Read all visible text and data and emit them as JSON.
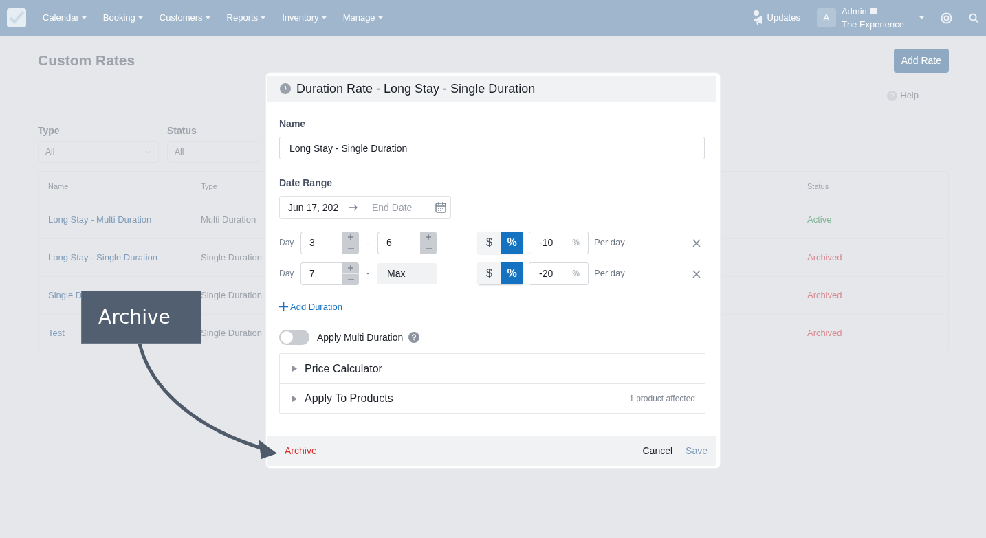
{
  "navbar": {
    "menu": [
      {
        "label": "Calendar"
      },
      {
        "label": "Booking"
      },
      {
        "label": "Customers"
      },
      {
        "label": "Reports"
      },
      {
        "label": "Inventory"
      },
      {
        "label": "Manage"
      }
    ],
    "updates": "Updates",
    "avatar": "A",
    "user": "Admin",
    "org": "The Experience"
  },
  "page": {
    "title": "Custom Rates",
    "add_button": "Add Rate",
    "help": "Help",
    "filters": [
      {
        "label": "Type",
        "value": "All"
      },
      {
        "label": "Status",
        "value": "All"
      }
    ],
    "table": {
      "columns": [
        "Name",
        "Type",
        "Status"
      ],
      "rows": [
        {
          "name": "Long Stay - Multi Duration",
          "type": "Multi Duration",
          "status": "Active",
          "color": "#7fb896"
        },
        {
          "name": "Long Stay - Single Duration",
          "type": "Single Duration",
          "status": "Archived",
          "color": "#d98990"
        },
        {
          "name": "Single D",
          "type": "Single Duration",
          "status": "Archived",
          "color": "#d98990"
        },
        {
          "name": "Test",
          "type": "Single Duration",
          "status": "Archived",
          "color": "#d98990"
        }
      ]
    }
  },
  "dialog": {
    "title": "Duration Rate - Long Stay - Single Duration",
    "name_label": "Name",
    "name_value": "Long Stay - Single Duration",
    "date_label": "Date Range",
    "start_date": "Jun 17, 202",
    "end_placeholder": "End Date",
    "durations": [
      {
        "kind": "stepper",
        "prefix": "Day",
        "from": "3",
        "separator": "-",
        "to": "6",
        "units": [
          {
            "label": "$",
            "selected": false
          },
          {
            "label": "%",
            "selected": true
          }
        ],
        "amount": "-10",
        "suffix": "%",
        "per": "Per day"
      },
      {
        "kind": "fixed",
        "prefix": "Day",
        "from": "7",
        "separator": "-",
        "to": "Max",
        "units": [
          {
            "label": "$",
            "selected": false
          },
          {
            "label": "%",
            "selected": true
          }
        ],
        "amount": "-20",
        "suffix": "%",
        "per": "Per day"
      }
    ],
    "add_duration": "Add Duration",
    "multi": {
      "label": "Apply Multi Duration",
      "on": false
    },
    "sections": [
      {
        "label": "Price Calculator",
        "expanded": false
      },
      {
        "label": "Apply To Products",
        "expanded": false,
        "note": "1 product affected"
      }
    ],
    "footer": {
      "archive": "Archive",
      "cancel": "Cancel",
      "save": "Save",
      "save_disabled": true
    }
  },
  "callout": {
    "label": "Archive"
  }
}
